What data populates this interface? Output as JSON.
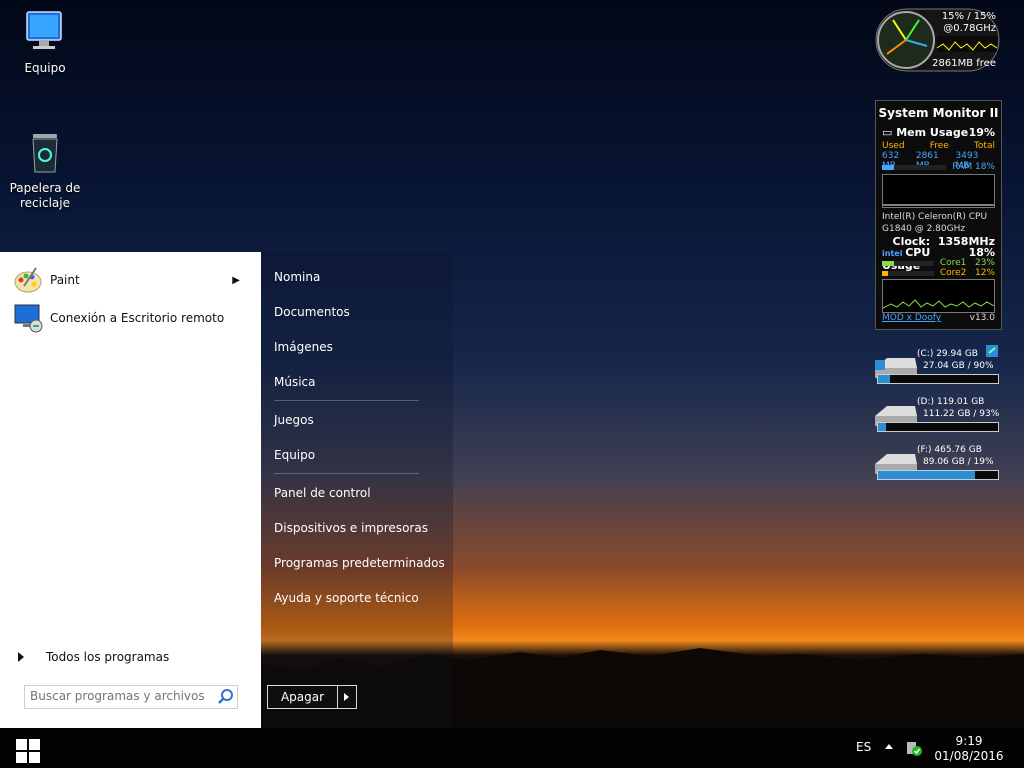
{
  "desktop": {
    "icons": [
      {
        "label": "Equipo"
      },
      {
        "label": "Papelera de\nreciclaje"
      }
    ]
  },
  "start_menu": {
    "pinned": [
      {
        "label": "Paint",
        "icon": "paint-icon",
        "has_submenu": true
      },
      {
        "label": "Conexión a Escritorio remoto",
        "icon": "remote-desktop-icon"
      }
    ],
    "all_programs": "Todos los programas",
    "search_placeholder": "Buscar programas y archivos",
    "right_items": [
      "Nomina",
      "Documentos",
      "Imágenes",
      "Música",
      "Juegos",
      "Equipo",
      "Panel de control",
      "Dispositivos e impresoras",
      "Programas predeterminados",
      "Ayuda y soporte técnico"
    ],
    "shutdown_label": "Apagar"
  },
  "taskbar": {
    "language": "ES",
    "time": "9:19",
    "date": "01/08/2016"
  },
  "gadgets": {
    "cpu_meter": {
      "cpu_text": "15% /  15%",
      "freq": "@0.78GHz",
      "free_mem": "2861MB free"
    },
    "system_monitor": {
      "title": "System Monitor II",
      "mem_label": "Mem Usage",
      "mem_percent": "19%",
      "used_label": "Used",
      "free_label": "Free",
      "total_label": "Total",
      "used": "632 MB",
      "free": "2861 MB",
      "total": "3493 MB",
      "ram_label": "RAM",
      "ram_percent": "18%",
      "cpu_name": "Intel(R) Celeron(R) CPU",
      "cpu_model": "G1840 @ 2.80GHz",
      "clock_label": "Clock:",
      "clock_value": "1358MHz",
      "cpu_usage_label": "CPU Usage",
      "cpu_usage": "18%",
      "core1_label": "Core1",
      "core1": "23%",
      "core2_label": "Core2",
      "core2": "12%",
      "link": "MOD x Doofy",
      "version": "v13.0",
      "mem_fraction": 0.18,
      "core1_fraction": 0.23,
      "core2_fraction": 0.12
    },
    "drives": [
      {
        "label": "(C:) 29.94 GB",
        "usage": "27.04 GB / 90%",
        "fraction": 0.1
      },
      {
        "label": "(D:) 119.01 GB",
        "usage": "111.22 GB / 93%",
        "fraction": 0.07
      },
      {
        "label": "(F:) 465.76 GB",
        "usage": "89.06 GB / 19%",
        "fraction": 0.81
      }
    ],
    "colors": {
      "accent": "#2a8fd6",
      "orange": "#ffb400",
      "green": "#8ad94a",
      "link": "#4aa3ff"
    }
  }
}
